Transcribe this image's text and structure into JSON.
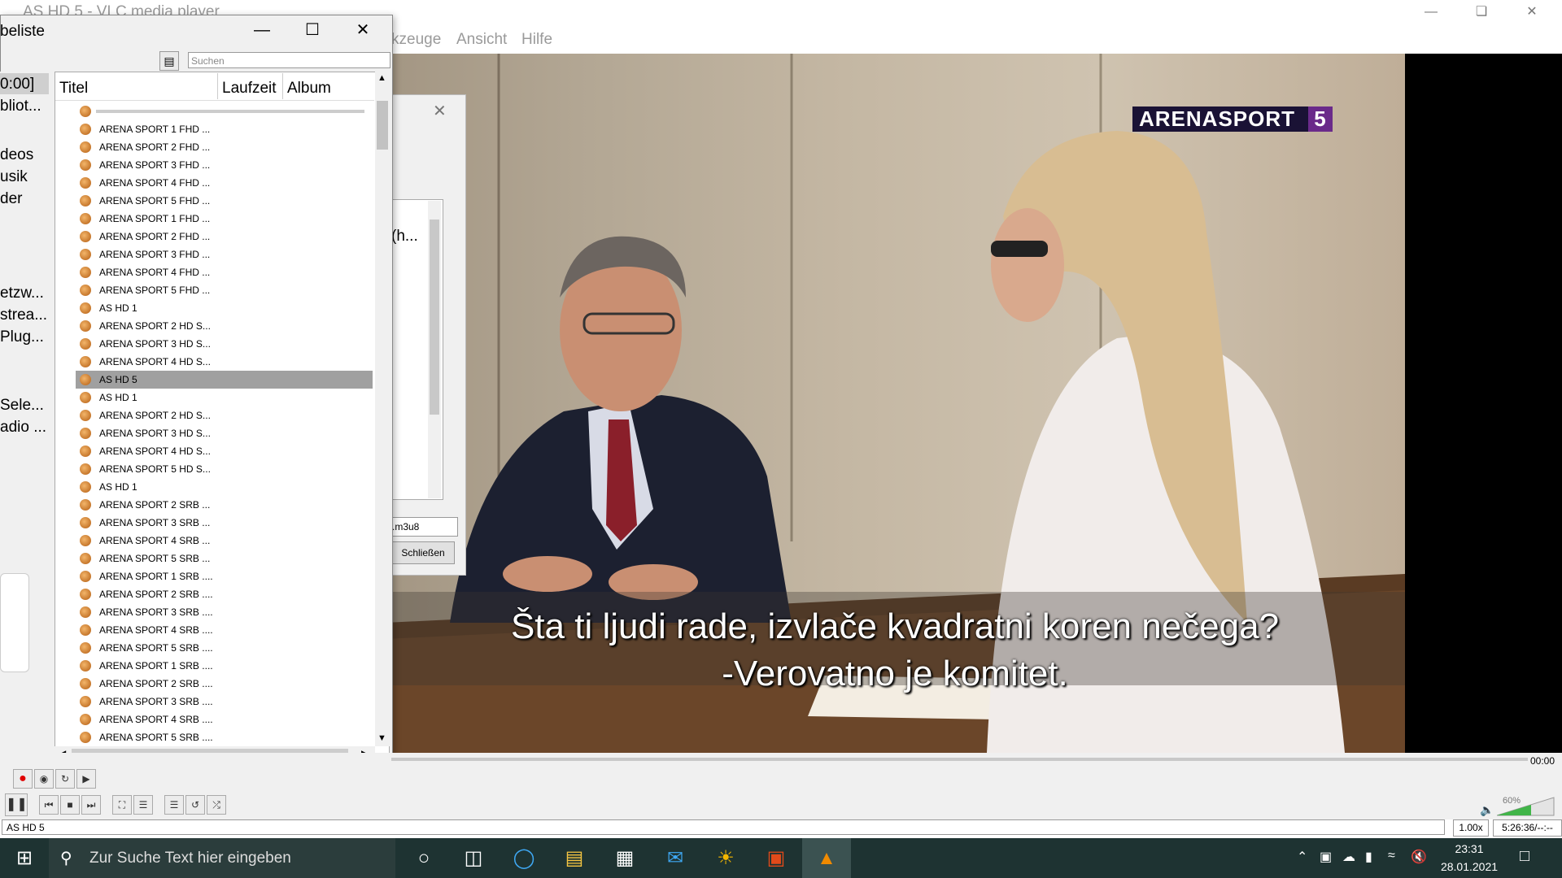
{
  "main": {
    "window_title": "AS HD 5 - VLC media player",
    "menus": [
      "kzeuge",
      "Ansicht",
      "Hilfe"
    ]
  },
  "video": {
    "channel_logo": "ARENASPORT",
    "channel_number": "5",
    "subtitle_line1": "Šta ti ljudi rade, izvlače kvadratni koren nečega?",
    "subtitle_line2": "-Verovatno je komitet."
  },
  "playlist": {
    "title": "beliste",
    "search_placeholder": "Suchen",
    "columns": [
      "Titel",
      "Laufzeit",
      "Album"
    ],
    "side_items": [
      "0:00]",
      "bliot...",
      "deos",
      "usik",
      "der",
      "etzw...",
      "strea...",
      "Plug...",
      "Sele...",
      "adio ..."
    ],
    "items": [
      "ARENA SPORT 1 FHD ...",
      "ARENA SPORT 2 FHD ...",
      "ARENA SPORT 3 FHD ...",
      "ARENA SPORT 4 FHD ...",
      "ARENA SPORT 5 FHD ...",
      "ARENA SPORT 1 FHD ...",
      "ARENA SPORT 2 FHD ...",
      "ARENA SPORT 3 FHD ...",
      "ARENA SPORT 4 FHD ...",
      "ARENA SPORT 5 FHD ...",
      "AS HD 1",
      "ARENA SPORT 2 HD S...",
      "ARENA SPORT 3 HD S...",
      "ARENA SPORT 4 HD S...",
      "AS HD 5",
      "AS HD 1",
      "ARENA SPORT 2 HD S...",
      "ARENA SPORT 3 HD S...",
      "ARENA SPORT 4 HD S...",
      "ARENA SPORT 5 HD S...",
      "AS HD 1",
      "ARENA SPORT 2 SRB ...",
      "ARENA SPORT 3 SRB ...",
      "ARENA SPORT 4 SRB ...",
      "ARENA SPORT 5 SRB ...",
      "ARENA SPORT 1 SRB ....",
      "ARENA SPORT 2 SRB ....",
      "ARENA SPORT 3 SRB ....",
      "ARENA SPORT 4 SRB ....",
      "ARENA SPORT 5 SRB ....",
      "ARENA SPORT 1 SRB ....",
      "ARENA SPORT 2 SRB ....",
      "ARENA SPORT 3 SRB ....",
      "ARENA SPORT 4 SRB ....",
      "ARENA SPORT 5 SRB ...."
    ],
    "selected_index": 14
  },
  "dialog": {
    "text_partial": "(h...",
    "field_value": ".m3u8",
    "close_button": "Schließen"
  },
  "controls": {
    "time_elapsed": "00:00",
    "volume_percent": "60%",
    "speed": "1.00x",
    "time_display": "5:26:36/--:--",
    "status_text": "AS HD 5"
  },
  "taskbar": {
    "search_placeholder": "Zur Suche Text hier eingeben",
    "time": "23:31",
    "date": "28.01.2021"
  }
}
